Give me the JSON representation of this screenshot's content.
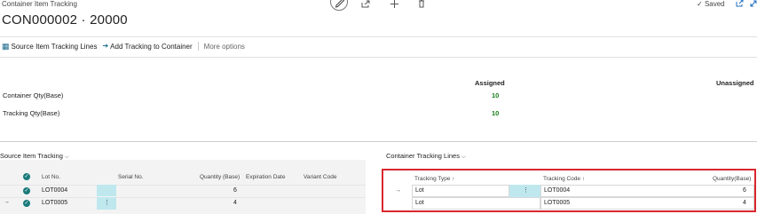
{
  "header": {
    "page_caption": "Container Item Tracking",
    "record_title": "CON000002 · 20000",
    "status": "Saved"
  },
  "actions": {
    "source_tracking_lines": "Source Item Tracking Lines",
    "add_tracking": "Add Tracking to Container",
    "more_options": "More options"
  },
  "summary": {
    "col_assigned": "Assigned",
    "col_unassigned": "Unassigned",
    "rows": [
      {
        "label": "Container Qty(Base)",
        "assigned": "10"
      },
      {
        "label": "Tracking Qty(Base)",
        "assigned": "10"
      }
    ]
  },
  "source_item_tracking": {
    "title": "Source Item Tracking",
    "columns": [
      "Lot No.",
      "Serial No.",
      "Quantity (Base)",
      "Expiration Date",
      "Variant Code"
    ],
    "rows": [
      {
        "lot": "LOT0004",
        "qty": "6"
      },
      {
        "lot": "LOT0005",
        "qty": "4"
      }
    ]
  },
  "container_tracking_lines": {
    "title": "Container Tracking Lines",
    "columns": [
      "Tracking Type ↑",
      "Tracking Code ↑",
      "Quantity(Base)"
    ],
    "rows": [
      {
        "type": "Lot",
        "code": "LOT0004",
        "qty": "6"
      },
      {
        "type": "Lot",
        "code": "LOT0005",
        "qty": "4"
      }
    ]
  },
  "colors": {
    "accent": "#1a7a7a",
    "assigned_value": "#1a7d1a",
    "highlight_border": "#d9272e",
    "selected_cell": "#bfe8ee"
  }
}
